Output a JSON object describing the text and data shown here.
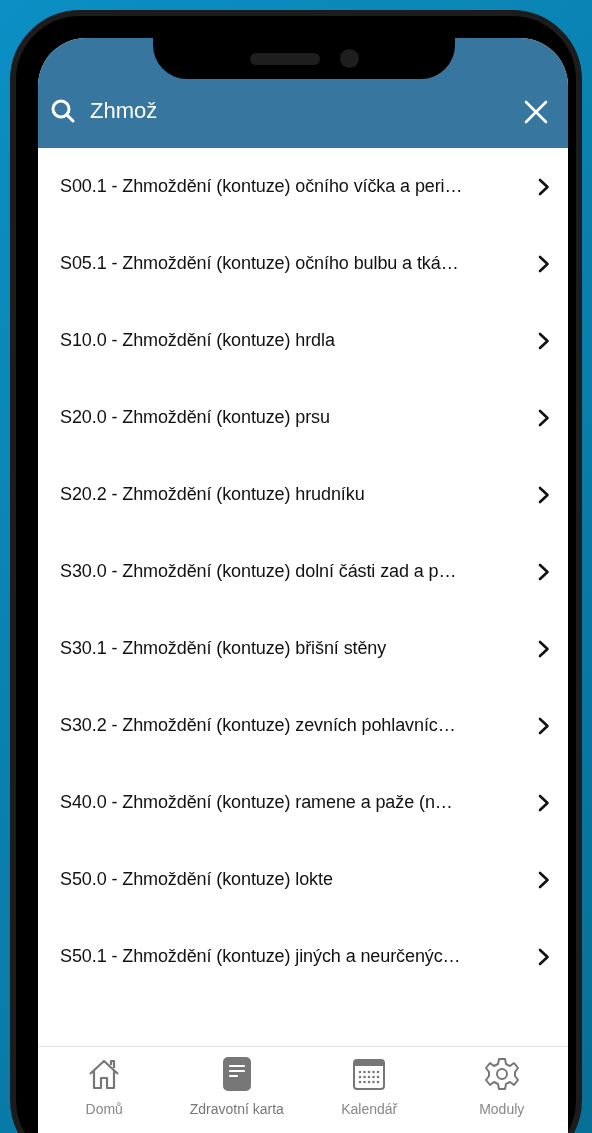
{
  "search": {
    "value": "Zhmož"
  },
  "results": [
    {
      "label": "S00.1 - Zhmoždění (kontuze) očního víčka a peri…"
    },
    {
      "label": "S05.1 - Zhmoždění (kontuze) očního bulbu a tká…"
    },
    {
      "label": "S10.0 - Zhmoždění (kontuze) hrdla"
    },
    {
      "label": "S20.0 - Zhmoždění (kontuze) prsu"
    },
    {
      "label": "S20.2 - Zhmoždění (kontuze) hrudníku"
    },
    {
      "label": "S30.0 - Zhmoždění (kontuze) dolní části zad a p…"
    },
    {
      "label": "S30.1 - Zhmoždění (kontuze) břišní stěny"
    },
    {
      "label": "S30.2 - Zhmoždění (kontuze) zevních pohlavníc…"
    },
    {
      "label": "S40.0 - Zhmoždění (kontuze) ramene a paže (n…"
    },
    {
      "label": "S50.0 - Zhmoždění (kontuze) lokte"
    },
    {
      "label": "S50.1 - Zhmoždění (kontuze) jiných a neurčenýc…"
    }
  ],
  "tab_bar": [
    {
      "kind": "home",
      "label": "Domů",
      "selected": false
    },
    {
      "kind": "card",
      "label": "Zdravotní karta",
      "selected": true
    },
    {
      "kind": "calendar",
      "label": "Kalendář",
      "selected": false
    },
    {
      "kind": "settings",
      "label": "Moduly",
      "selected": false
    }
  ]
}
